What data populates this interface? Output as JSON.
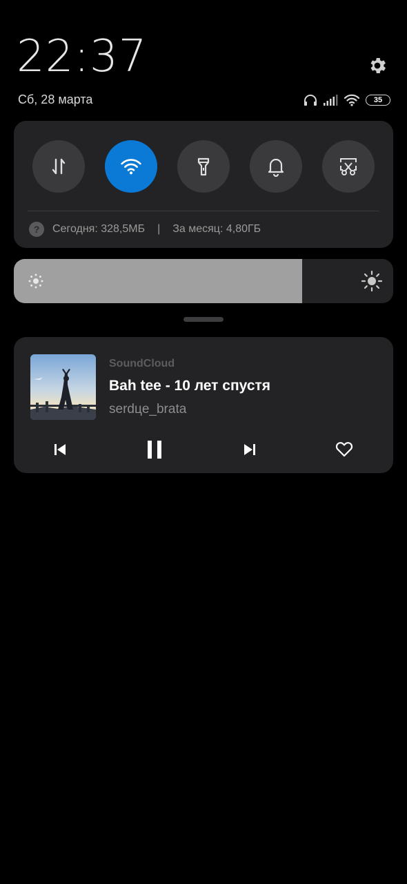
{
  "status": {
    "time": "22:37",
    "date": "Сб, 28 марта",
    "battery_level": "35",
    "icons": [
      "headphones-icon",
      "signal-icon",
      "wifi-icon",
      "battery-icon",
      "gear-icon"
    ]
  },
  "quick_settings": {
    "toggles": [
      {
        "name": "mobile-data",
        "icon": "data-transfer-icon",
        "active": false
      },
      {
        "name": "wifi",
        "icon": "wifi-icon",
        "active": true
      },
      {
        "name": "flashlight",
        "icon": "flashlight-icon",
        "active": false
      },
      {
        "name": "ringer",
        "icon": "bell-icon",
        "active": false
      },
      {
        "name": "screenshot",
        "icon": "scissors-screenshot-icon",
        "active": false
      }
    ],
    "data_usage": {
      "today": "Сегодня: 328,5МБ",
      "separator": "|",
      "month": "За месяц: 4,80ГБ"
    },
    "accent_color": "#0a7ad6"
  },
  "brightness": {
    "level": 0.76
  },
  "media": {
    "app": "SoundCloud",
    "title": "Bah tee - 10 лет спустя",
    "artist": "serdцe_brata",
    "controls": [
      "previous-icon",
      "pause-icon",
      "next-icon",
      "heart-icon"
    ]
  }
}
